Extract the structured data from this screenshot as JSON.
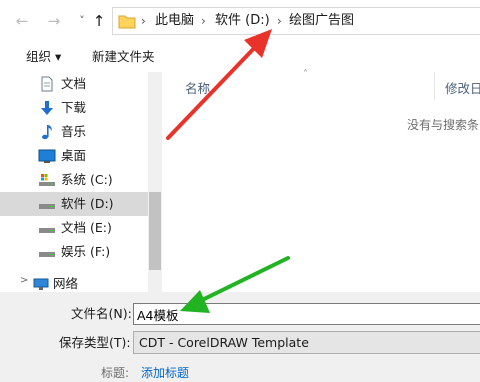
{
  "nav": {
    "back": "←",
    "forward": "→",
    "recent": "˅",
    "up": "↑"
  },
  "address": {
    "crumbs": [
      "此电脑",
      "软件 (D:)",
      "绘图广告图"
    ],
    "separator": "›"
  },
  "toolbar": {
    "organize": "组织 ▾",
    "new_folder": "新建文件夹"
  },
  "sidebar": {
    "items": [
      {
        "label": "文档",
        "icon": "document-icon"
      },
      {
        "label": "下载",
        "icon": "download-icon"
      },
      {
        "label": "音乐",
        "icon": "music-icon"
      },
      {
        "label": "桌面",
        "icon": "desktop-icon"
      },
      {
        "label": "系统 (C:)",
        "icon": "system-drive-icon"
      },
      {
        "label": "软件 (D:)",
        "icon": "drive-icon",
        "selected": true
      },
      {
        "label": "文档 (E:)",
        "icon": "drive-icon"
      },
      {
        "label": "娱乐 (F:)",
        "icon": "drive-icon"
      },
      {
        "label": "网络",
        "icon": "network-icon"
      }
    ]
  },
  "filelist": {
    "columns": [
      "名称",
      "修改日"
    ],
    "empty_message": "没有与搜索条"
  },
  "form": {
    "filename_label": "文件名(N):",
    "filename_value": "A4模板",
    "filetype_label": "保存类型(T):",
    "filetype_value": "CDT - CorelDRAW Template",
    "title_label": "标题:",
    "title_link": "添加标题"
  },
  "colors": {
    "selected_bg": "#d9d9d9",
    "red_arrow": "#e8322a",
    "green_arrow": "#22b322",
    "link": "#0066cc",
    "folder": "#ffd35c"
  }
}
